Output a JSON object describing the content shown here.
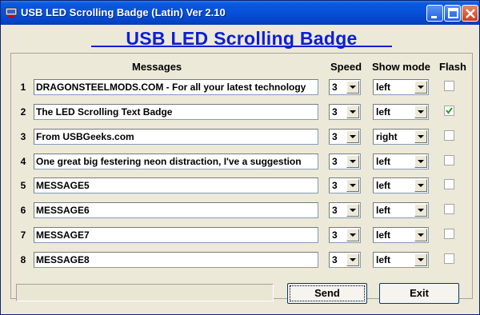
{
  "window": {
    "title": "USB LED Scrolling Badge (Latin) Ver 2.10"
  },
  "banner": "USB LED Scrolling Badge",
  "headers": {
    "messages": "Messages",
    "speed": "Speed",
    "show_mode": "Show mode",
    "flash": "Flash"
  },
  "rows": [
    {
      "num": "1",
      "message": "DRAGONSTEELMODS.COM - For all your latest technology",
      "speed": "3",
      "mode": "left",
      "flash": false
    },
    {
      "num": "2",
      "message": "The LED Scrolling Text Badge",
      "speed": "3",
      "mode": "left",
      "flash": true
    },
    {
      "num": "3",
      "message": "From USBGeeks.com",
      "speed": "3",
      "mode": "right",
      "flash": false
    },
    {
      "num": "4",
      "message": "One great big festering neon distraction, I've a suggestion",
      "speed": "3",
      "mode": "left",
      "flash": false
    },
    {
      "num": "5",
      "message": "MESSAGE5",
      "speed": "3",
      "mode": "left",
      "flash": false
    },
    {
      "num": "6",
      "message": "MESSAGE6",
      "speed": "3",
      "mode": "left",
      "flash": false
    },
    {
      "num": "7",
      "message": "MESSAGE7",
      "speed": "3",
      "mode": "left",
      "flash": false
    },
    {
      "num": "8",
      "message": "MESSAGE8",
      "speed": "3",
      "mode": "left",
      "flash": false
    }
  ],
  "buttons": {
    "send": "Send",
    "exit": "Exit"
  },
  "colors": {
    "banner": "#0b1fd6",
    "titlebar": "#0650d8"
  }
}
